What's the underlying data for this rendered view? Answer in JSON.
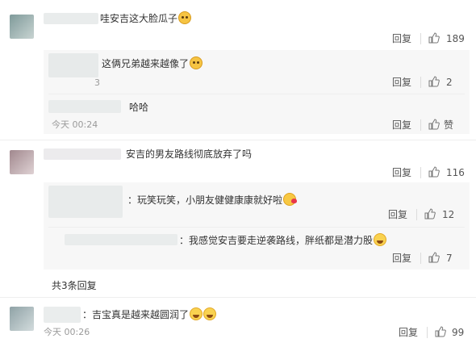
{
  "comments": [
    {
      "text": "哇安吉这大脸瓜子",
      "emoji": "cat-face-emoji",
      "reply_label": "回复",
      "likes": "189",
      "replies": [
        {
          "text": "这俩兄弟越来越像了",
          "emoji": "cat-face-emoji",
          "time": "3",
          "reply_label": "回复",
          "likes": "2"
        },
        {
          "text": "哈哈",
          "time": "今天 00:24",
          "reply_label": "回复",
          "likes": "赞"
        }
      ]
    },
    {
      "text": "安吉的男友路线彻底放弃了吗",
      "reply_label": "回复",
      "likes": "116",
      "replies": [
        {
          "text": "：玩笑玩笑，小朋友健健康康就好啦",
          "emoji": "kiss-emoji",
          "reply_label": "回复",
          "likes": "12"
        },
        {
          "text": "：我感觉安吉要走逆袭路线，胖纸都是潜力股",
          "emoji": "laugh-emoji",
          "reply_label": "回复",
          "likes": "7"
        }
      ],
      "more_replies": "共3条回复"
    },
    {
      "text": "：吉宝真是越来越圆润了",
      "emoji": "laugh-emoji",
      "time": "今天 00:26",
      "reply_label": "回复",
      "likes": "99"
    }
  ],
  "colors": {
    "text": "#333333",
    "muted": "#9a9a9a",
    "bg": "#ffffff",
    "reply_bg": "#f7f7f7"
  }
}
